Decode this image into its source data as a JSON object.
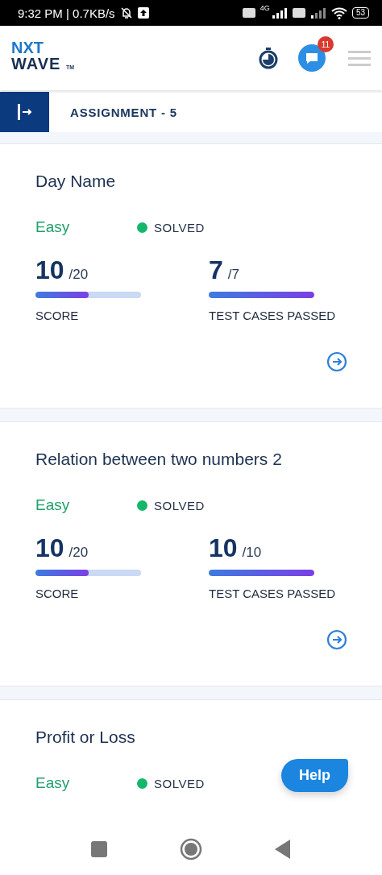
{
  "status_bar": {
    "time": "9:32 PM | 0.7KB/s",
    "network": "4G",
    "battery": "53"
  },
  "header": {
    "logo_top": "NXT",
    "logo_bottom": "WAVE",
    "logo_mark": "TM",
    "notification_count": "11"
  },
  "assignment_bar": {
    "title": "ASSIGNMENT - 5"
  },
  "questions": [
    {
      "title": "Day Name",
      "difficulty": "Easy",
      "status": "SOLVED",
      "color": "#12b76a",
      "stats": [
        {
          "value": "10",
          "total": "/20",
          "level": 0.5,
          "label": "SCORE"
        },
        {
          "value": "7",
          "total": "/7",
          "level": 1,
          "label": "TEST CASES PASSED"
        }
      ]
    },
    {
      "title": "Relation between two numbers 2",
      "difficulty": "Easy",
      "status": "SOLVED",
      "color": "#12b76a",
      "stats": [
        {
          "value": "10",
          "total": "/20",
          "level": 0.5,
          "label": "SCORE"
        },
        {
          "value": "10",
          "total": "/10",
          "level": 1,
          "label": "TEST CASES PASSED"
        }
      ]
    },
    {
      "title": "Profit or Loss",
      "difficulty": "Easy",
      "status": "SOLVED",
      "color": "#12b76a"
    }
  ],
  "help_button": {
    "label": "Help"
  }
}
